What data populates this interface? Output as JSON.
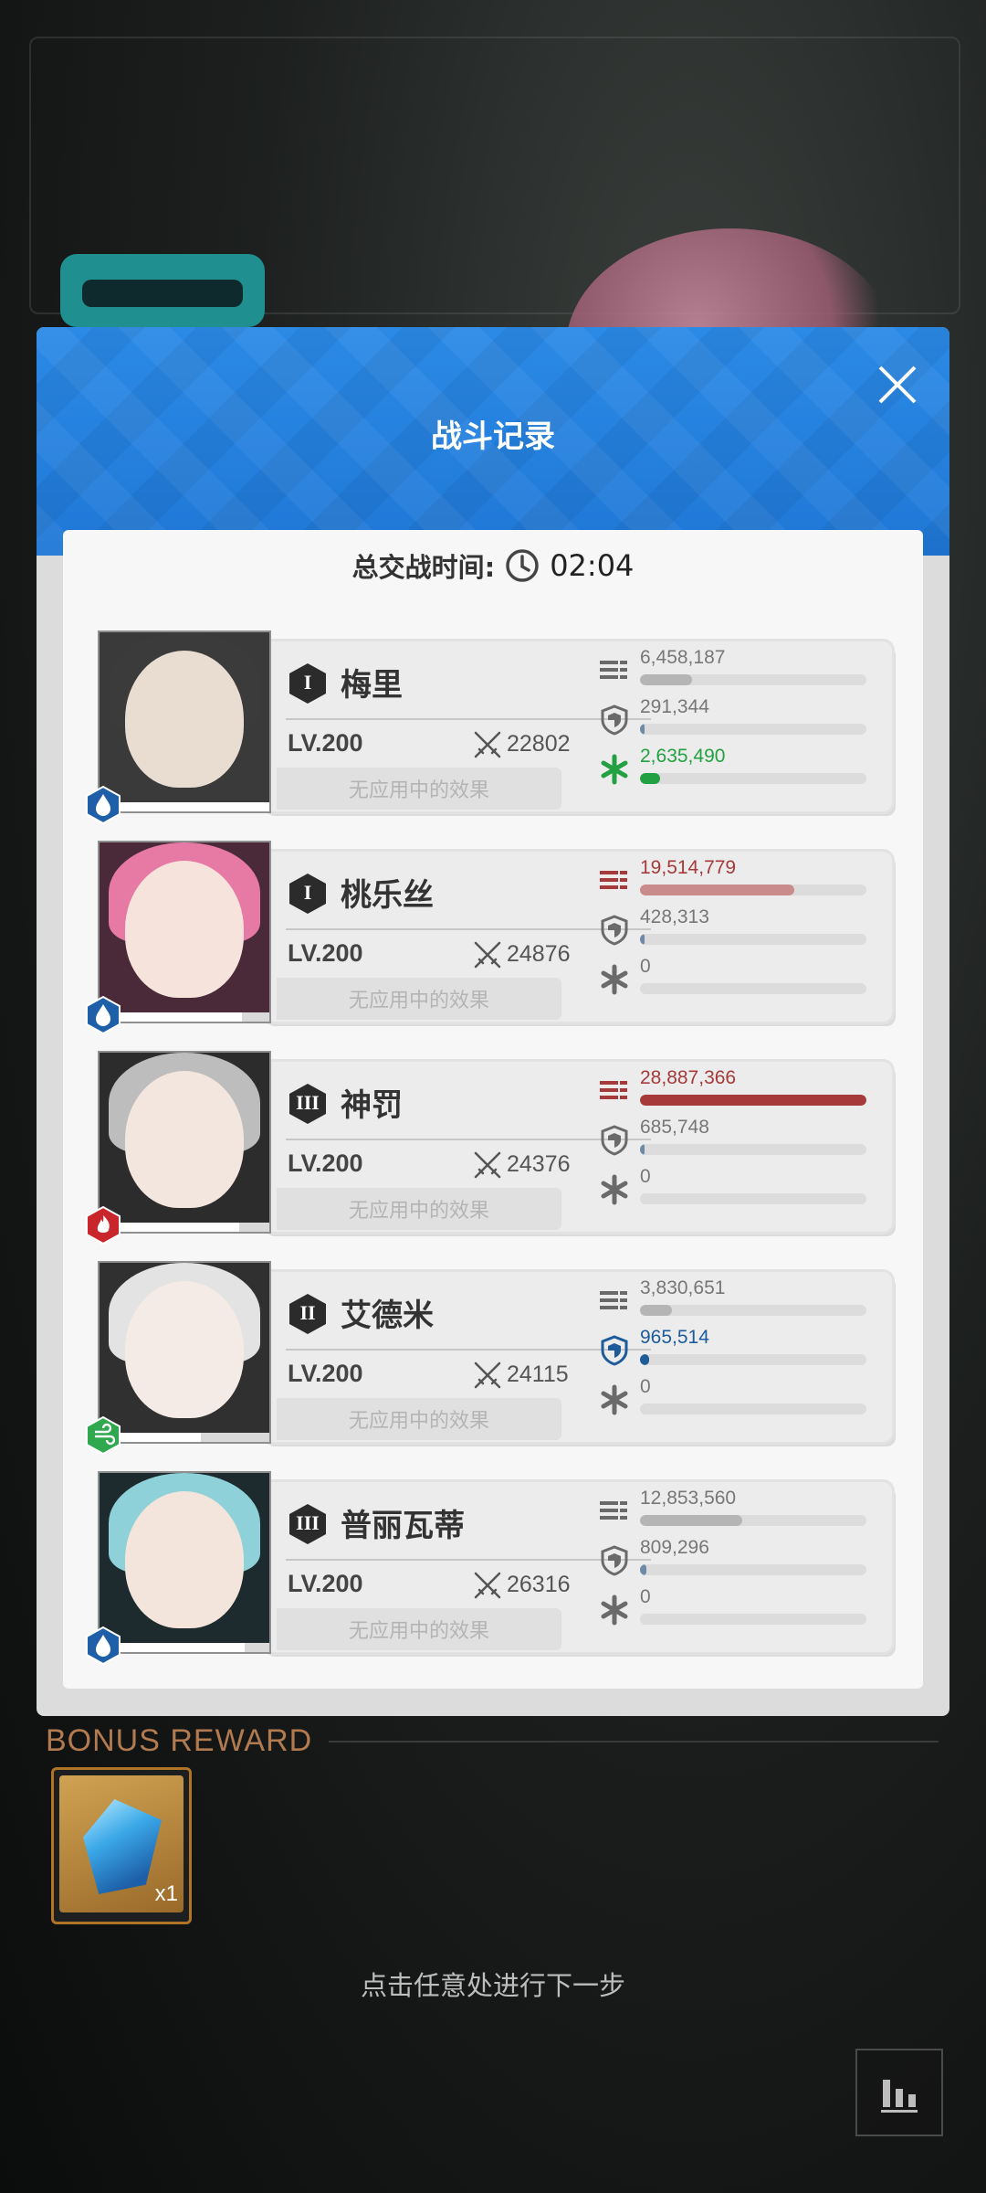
{
  "modal": {
    "title": "战斗记录",
    "duration_label": "总交战时间:",
    "duration_value": "02:04",
    "close_icon": "close-icon"
  },
  "colors": {
    "header_blue": "#2283e0",
    "water_element": "#1f5fa8",
    "fire_element": "#c8262a",
    "wind_element": "#2fa84f",
    "damage_high": "#a63a3a",
    "damage_mid": "#c98b8b",
    "defense_blue": "#1d5b9a",
    "heal_green": "#23a142"
  },
  "characters": [
    {
      "name": "梅里",
      "rank": "I",
      "level": "LV.200",
      "power": "22802",
      "effects": "无应用中的效果",
      "element": "water",
      "damage": "6,458,187",
      "damage_fill": 0.23,
      "defense": "291,344",
      "defense_fill": 0.02,
      "heal": "2,635,490",
      "heal_fill": 0.09,
      "hp_fill": 1.0
    },
    {
      "name": "桃乐丝",
      "rank": "I",
      "level": "LV.200",
      "power": "24876",
      "effects": "无应用中的效果",
      "element": "water",
      "damage": "19,514,779",
      "damage_fill": 0.68,
      "defense": "428,313",
      "defense_fill": 0.02,
      "heal": "0",
      "heal_fill": 0,
      "hp_fill": 0.82
    },
    {
      "name": "神罚",
      "rank": "III",
      "level": "LV.200",
      "power": "24376",
      "effects": "无应用中的效果",
      "element": "fire",
      "damage": "28,887,366",
      "damage_fill": 1.0,
      "defense": "685,748",
      "defense_fill": 0.02,
      "heal": "0",
      "heal_fill": 0,
      "hp_fill": 0.8
    },
    {
      "name": "艾德米",
      "rank": "II",
      "level": "LV.200",
      "power": "24115",
      "effects": "无应用中的效果",
      "element": "wind",
      "damage": "3,830,651",
      "damage_fill": 0.14,
      "defense": "965,514",
      "defense_fill": 0.04,
      "heal": "0",
      "heal_fill": 0,
      "hp_fill": 0.55
    },
    {
      "name": "普丽瓦蒂",
      "rank": "III",
      "level": "LV.200",
      "power": "26316",
      "effects": "无应用中的效果",
      "element": "water",
      "damage": "12,853,560",
      "damage_fill": 0.45,
      "defense": "809,296",
      "defense_fill": 0.03,
      "heal": "0",
      "heal_fill": 0,
      "hp_fill": 0.84
    }
  ],
  "bonus": {
    "label": "BONUS REWARD",
    "item_quantity": "x1",
    "item_icon": "blue-crystal-icon"
  },
  "hint": "点击任意处进行下一步",
  "stats_button_icon": "bar-chart-icon"
}
